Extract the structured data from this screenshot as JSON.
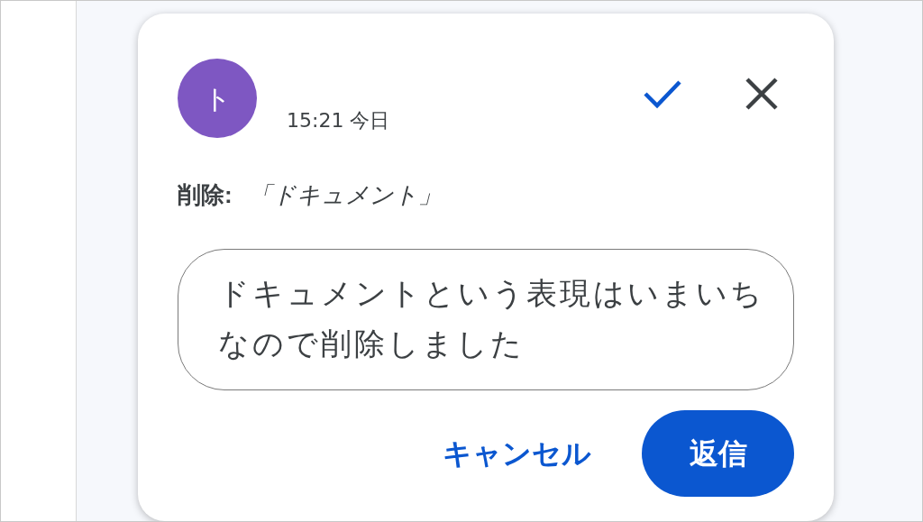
{
  "comment": {
    "avatar_initial": "ト",
    "timestamp": "15:21 今日"
  },
  "suggestion": {
    "label": "削除:",
    "text": "「ドキュメント」"
  },
  "reply": {
    "value": "ドキュメントという表現はいまいちなので削除しました"
  },
  "buttons": [
    {
      "label": "キャンセル",
      "kind": "text"
    },
    {
      "label": "返信",
      "kind": "filled"
    }
  ]
}
